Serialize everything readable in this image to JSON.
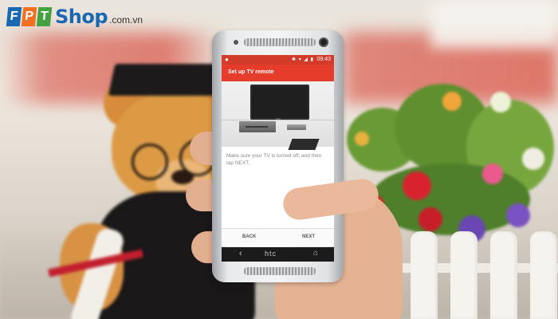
{
  "watermark": {
    "brand_letters": [
      "F",
      "P",
      "T"
    ],
    "brand_word": "Shop",
    "domain": ".com.vn",
    "colors": {
      "f": "#1a67b2",
      "p": "#f37021",
      "t": "#45a242",
      "shop": "#1a67b2"
    }
  },
  "phone": {
    "status_bar": {
      "time": "09:43",
      "icons": "✱ ▾ ◢ ▮",
      "app_glyph": "●"
    },
    "screen_title": "Set up TV remote",
    "instruction": "Make sure your TV is turned off, and then tap NEXT.",
    "nav": {
      "back_label": "BACK",
      "next_label": "NEXT"
    },
    "hardware": {
      "back_glyph": "‹",
      "logo_text": "htc",
      "home_glyph": "⌂"
    },
    "accent_color": "#e53c2b"
  }
}
